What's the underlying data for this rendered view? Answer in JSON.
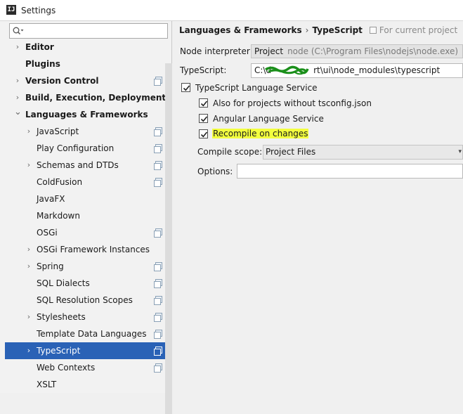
{
  "window": {
    "title": "Settings",
    "app_icon": "intellij-icon"
  },
  "sidebar": {
    "search": {
      "value": "",
      "placeholder": ""
    },
    "items": [
      {
        "label": "Editor",
        "bold": true,
        "expanded": false,
        "has_arrow": true,
        "level": 0,
        "copy_icon": false
      },
      {
        "label": "Plugins",
        "bold": true,
        "has_arrow": false,
        "level": 0,
        "copy_icon": false
      },
      {
        "label": "Version Control",
        "bold": true,
        "expanded": false,
        "has_arrow": true,
        "level": 0,
        "copy_icon": true
      },
      {
        "label": "Build, Execution, Deployment",
        "bold": true,
        "expanded": false,
        "has_arrow": true,
        "level": 0,
        "copy_icon": false
      },
      {
        "label": "Languages & Frameworks",
        "bold": true,
        "expanded": true,
        "has_arrow": true,
        "level": 0,
        "copy_icon": false
      },
      {
        "label": "JavaScript",
        "has_arrow": true,
        "level": 1,
        "copy_icon": true
      },
      {
        "label": "Play Configuration",
        "has_arrow": false,
        "level": 1,
        "copy_icon": true
      },
      {
        "label": "Schemas and DTDs",
        "has_arrow": true,
        "level": 1,
        "copy_icon": true
      },
      {
        "label": "ColdFusion",
        "has_arrow": false,
        "level": 1,
        "copy_icon": true
      },
      {
        "label": "JavaFX",
        "has_arrow": false,
        "level": 1,
        "copy_icon": false
      },
      {
        "label": "Markdown",
        "has_arrow": false,
        "level": 1,
        "copy_icon": false
      },
      {
        "label": "OSGi",
        "has_arrow": false,
        "level": 1,
        "copy_icon": true
      },
      {
        "label": "OSGi Framework Instances",
        "has_arrow": true,
        "level": 1,
        "copy_icon": false
      },
      {
        "label": "Spring",
        "has_arrow": true,
        "level": 1,
        "copy_icon": true
      },
      {
        "label": "SQL Dialects",
        "has_arrow": false,
        "level": 1,
        "copy_icon": true
      },
      {
        "label": "SQL Resolution Scopes",
        "has_arrow": false,
        "level": 1,
        "copy_icon": true
      },
      {
        "label": "Stylesheets",
        "has_arrow": true,
        "level": 1,
        "copy_icon": true
      },
      {
        "label": "Template Data Languages",
        "has_arrow": false,
        "level": 1,
        "copy_icon": true
      },
      {
        "label": "TypeScript",
        "has_arrow": true,
        "level": 1,
        "copy_icon": true,
        "selected": true
      },
      {
        "label": "Web Contexts",
        "has_arrow": false,
        "level": 1,
        "copy_icon": true
      },
      {
        "label": "XSLT",
        "has_arrow": false,
        "level": 1,
        "copy_icon": false
      }
    ]
  },
  "breadcrumb": {
    "parent": "Languages & Frameworks",
    "separator": "›",
    "current": "TypeScript",
    "scope": "For current project"
  },
  "form": {
    "node_interpreter": {
      "label": "Node interpreter:",
      "project": "Project",
      "value": "node (C:\\Program Files\\nodejs\\node.exe)"
    },
    "typescript": {
      "label": "TypeScript:",
      "value_start": "C:\\d",
      "value_end": "rt\\ui\\node_modules\\typescript"
    },
    "checkboxes": {
      "service": {
        "label": "TypeScript Language Service",
        "checked": true
      },
      "no_tsconfig": {
        "label": "Also for projects without tsconfig.json",
        "checked": true
      },
      "angular": {
        "label": "Angular Language Service",
        "checked": true
      },
      "recompile": {
        "label": "Recompile on changes",
        "checked": true,
        "highlight": "#f3ff3f"
      }
    },
    "compile_scope": {
      "label": "Compile scope:",
      "value": "Project Files"
    },
    "options": {
      "label": "Options:",
      "value": ""
    }
  },
  "colors": {
    "selection": "#2a62b6",
    "highlight": "#f3ff3f",
    "scribble": "#1a8f1a"
  }
}
